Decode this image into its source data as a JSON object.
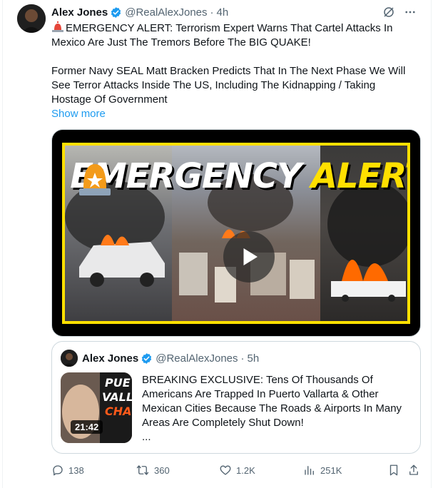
{
  "author": {
    "name": "Alex Jones",
    "handle": "@RealAlexJones",
    "time": "4h",
    "separator": "·"
  },
  "tweet": {
    "line1": "EMERGENCY ALERT: Terrorism Expert Warns That Cartel Attacks In Mexico Are Just The Tremors Before The BIG QUAKE!",
    "line2": "Former Navy SEAL Matt Bracken Predicts That In The Next Phase We Will See Terror Attacks Inside The US, Including The Kidnapping / Taking Hostage Of Government",
    "show_more": "Show more"
  },
  "media": {
    "title_white": "EMERGENCY",
    "title_yellow": "ALERT!",
    "accent": "#ffe000"
  },
  "quote": {
    "name": "Alex Jones",
    "handle": "@RealAlexJones",
    "time": "5h",
    "separator": "·",
    "duration": "21:42",
    "text": "BREAKING EXCLUSIVE: Tens Of Thousands Of Americans Are Trapped In Puerto Vallarta & Other Mexican Cities Because The Roads & Airports In Many Areas Are Completely Shut Down!",
    "ellipsis": "..."
  },
  "actions": {
    "replies": "138",
    "reposts": "360",
    "likes": "1.2K",
    "views": "251K"
  },
  "colors": {
    "link": "#1d9bf0",
    "verified": "#1d9bf0",
    "muted": "#536471"
  }
}
